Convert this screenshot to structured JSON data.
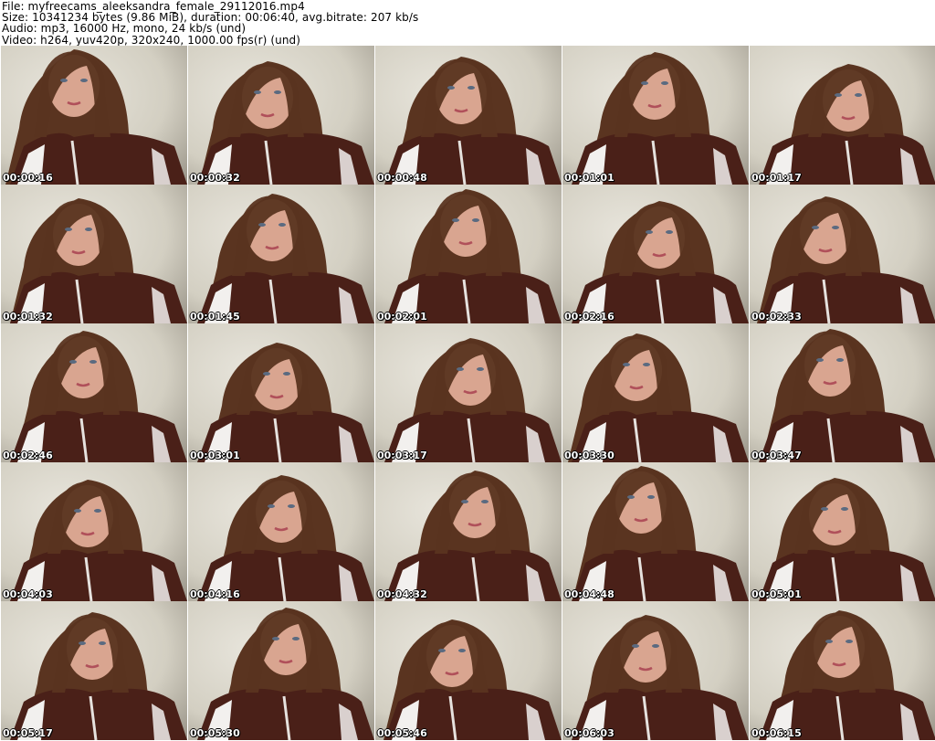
{
  "header": {
    "file_line": "File: myfreecams_aleeksandra_female_29112016.mp4",
    "size_line": "Size: 10341234 bytes (9.86 MiB), duration: 00:06:40, avg.bitrate: 207 kb/s",
    "audio_line": "Audio: mp3, 16000 Hz, mono, 24 kb/s (und)",
    "video_line": "Video: h264, yuv420p, 320x240, 1000.00 fps(r) (und)"
  },
  "thumbnails": [
    {
      "timestamp": "00:00:16"
    },
    {
      "timestamp": "00:00:32"
    },
    {
      "timestamp": "00:00:48"
    },
    {
      "timestamp": "00:01:01"
    },
    {
      "timestamp": "00:01:17"
    },
    {
      "timestamp": "00:01:32"
    },
    {
      "timestamp": "00:01:45"
    },
    {
      "timestamp": "00:02:01"
    },
    {
      "timestamp": "00:02:16"
    },
    {
      "timestamp": "00:02:33"
    },
    {
      "timestamp": "00:02:46"
    },
    {
      "timestamp": "00:03:01"
    },
    {
      "timestamp": "00:03:17"
    },
    {
      "timestamp": "00:03:30"
    },
    {
      "timestamp": "00:03:47"
    },
    {
      "timestamp": "00:04:03"
    },
    {
      "timestamp": "00:04:16"
    },
    {
      "timestamp": "00:04:32"
    },
    {
      "timestamp": "00:04:48"
    },
    {
      "timestamp": "00:05:01"
    },
    {
      "timestamp": "00:05:17"
    },
    {
      "timestamp": "00:05:30"
    },
    {
      "timestamp": "00:05:46"
    },
    {
      "timestamp": "00:06:03"
    },
    {
      "timestamp": "00:06:15"
    }
  ],
  "colors": {
    "wall": "#d3cfc2",
    "jacket": "#4a2018",
    "stripe": "#f2f0ee",
    "hair": "#5a3420",
    "skin": "#d9a590"
  }
}
